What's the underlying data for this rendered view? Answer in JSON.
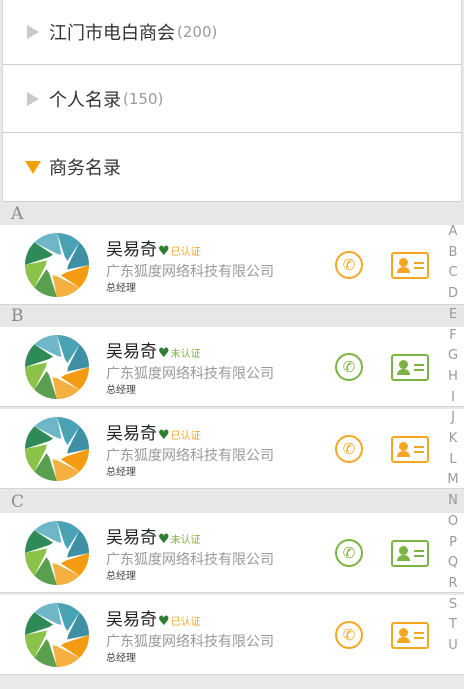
{
  "groups": [
    {
      "name": "江门市电白商会",
      "count": "(200)"
    },
    {
      "name": "个人名录",
      "count": "(150)"
    },
    {
      "name": "商务名录",
      "count": ""
    }
  ],
  "sections": [
    {
      "letter": "A"
    },
    {
      "letter": "B"
    },
    {
      "letter": "C"
    }
  ],
  "contacts": [
    {
      "name": "吴易奇",
      "badge": "已认证",
      "company": "广东狐度网络科技有限公司",
      "title": "总经理",
      "verified": true
    },
    {
      "name": "吴易奇",
      "badge": "未认证",
      "company": "广东狐度网络科技有限公司",
      "title": "总经理",
      "verified": false
    },
    {
      "name": "吴易奇",
      "badge": "已认证",
      "company": "广东狐度网络科技有限公司",
      "title": "总经理",
      "verified": true
    },
    {
      "name": "吴易奇",
      "badge": "未认证",
      "company": "广东狐度网络科技有限公司",
      "title": "总经理",
      "verified": false
    },
    {
      "name": "吴易奇",
      "badge": "已认证",
      "company": "广东狐度网络科技有限公司",
      "title": "总经理",
      "verified": true
    }
  ],
  "icons": {
    "expand": "triangle-right-icon",
    "collapse": "triangle-down-icon",
    "avatar": "aperture-logo-icon",
    "heart": "heart-icon",
    "phone": "phone-icon",
    "card": "business-card-icon"
  },
  "colors": {
    "verified": "#f5a623",
    "unverified": "#7cb342",
    "heart_left": "#2e7d32",
    "heart_right": "#e53935",
    "index_text": "#9a9a9a"
  },
  "index_letters": [
    "A",
    "B",
    "C",
    "D",
    "E",
    "F",
    "G",
    "H",
    "I",
    "J",
    "K",
    "L",
    "M",
    "N",
    "O",
    "P",
    "Q",
    "R",
    "S",
    "T",
    "U"
  ]
}
